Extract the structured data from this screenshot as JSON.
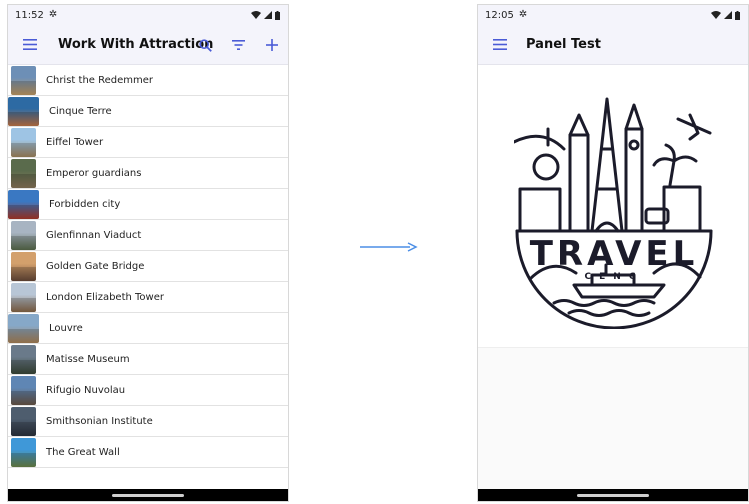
{
  "left_screen": {
    "status": {
      "time": "11:52"
    },
    "appbar": {
      "title": "Work With Attraction"
    },
    "items": [
      {
        "label": "Christ the Redemmer",
        "c1": "#6d8fb6",
        "c2": "#c9a067",
        "shape": "tall"
      },
      {
        "label": "Cinque Terre",
        "c1": "#2d6aa3",
        "c2": "#c97a4a",
        "shape": "wide"
      },
      {
        "label": "Eiffel Tower",
        "c1": "#9ec4e4",
        "c2": "#a88b62",
        "shape": "tall"
      },
      {
        "label": "Emperor guardians",
        "c1": "#5a6b4c",
        "c2": "#8e7a5c",
        "shape": "tall"
      },
      {
        "label": "Forbidden city",
        "c1": "#3a78c2",
        "c2": "#b23a2a",
        "shape": "wide"
      },
      {
        "label": "Glenfinnan Viaduct",
        "c1": "#a8b4c2",
        "c2": "#5c6f4e",
        "shape": "tall"
      },
      {
        "label": "Golden Gate Bridge",
        "c1": "#d3a06c",
        "c2": "#6b4b3a",
        "shape": "tall"
      },
      {
        "label": "London Elizabeth Tower",
        "c1": "#b8c6d6",
        "c2": "#8c6b4a",
        "shape": "tall"
      },
      {
        "label": "Louvre",
        "c1": "#86a8c8",
        "c2": "#b0875a",
        "shape": "wide"
      },
      {
        "label": "Matisse Museum",
        "c1": "#6a7a8a",
        "c2": "#3c4a3a",
        "shape": "tall"
      },
      {
        "label": "Rifugio Nuvolau",
        "c1": "#5f86b4",
        "c2": "#6d5a4a",
        "shape": "tall"
      },
      {
        "label": "Smithsonian Institute",
        "c1": "#4e5d6e",
        "c2": "#2d3440",
        "shape": "tall"
      },
      {
        "label": "The Great Wall",
        "c1": "#3f98d8",
        "c2": "#6f8a4a",
        "shape": "tall"
      }
    ]
  },
  "right_screen": {
    "status": {
      "time": "12:05"
    },
    "appbar": {
      "title": "Panel Test"
    },
    "logo": {
      "main_text": "TRAVEL",
      "sub_text": "CENC"
    }
  },
  "colors": {
    "accent": "#4a5bd6",
    "appbar_bg": "#f4f4fb",
    "arrow": "#4b8ee6"
  },
  "icons": {
    "menu": "menu-icon",
    "search": "search-icon",
    "filter": "filter-icon",
    "add": "add-icon",
    "settings": "gear-icon",
    "wifi": "wifi-icon",
    "signal": "signal-icon",
    "battery": "battery-icon"
  }
}
